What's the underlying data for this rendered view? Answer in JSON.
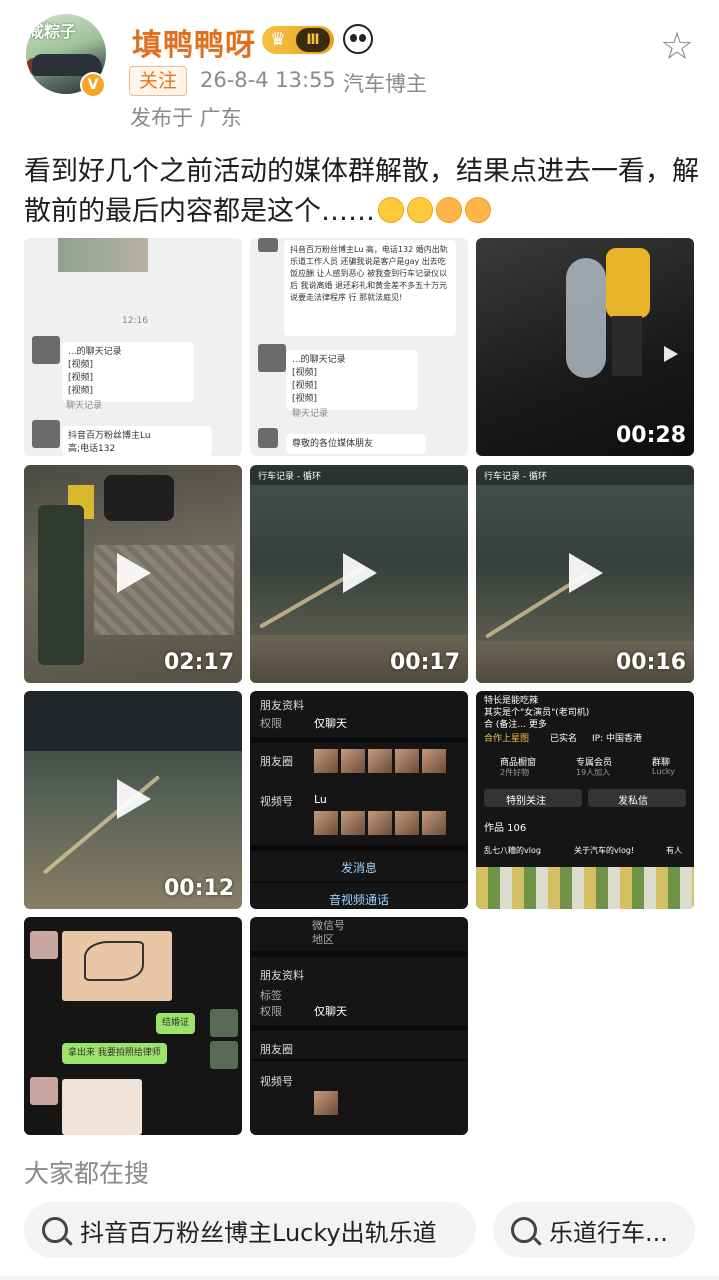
{
  "header": {
    "avatar_text": "咸粽子",
    "username": "填鸭鸭呀",
    "level_badge": "Ⅲ",
    "follow_label": "关注",
    "timestamp": "26-8-4 13:55",
    "user_tag": "汽车博主",
    "location": "发布于 广东"
  },
  "post": {
    "text": "看到好几个之前活动的媒体群解散，结果点进去一看，解散前的最后内容都是这个……"
  },
  "grid": {
    "cell1": {
      "time": "12:16",
      "forward_title": "...的聊天记录",
      "item1": "[视频]",
      "item2": "[视频]",
      "item3": "[视频]",
      "footer": "聊天记录",
      "bottom_text": "抖音百万粉丝博主Lu",
      "bottom_text2": "高;电话132"
    },
    "cell2": {
      "top_text": "抖音百万粉丝博主Lu 高，电话132 婚内出轨乐道工作人员 还骗我说是客户是gay 出去吃饭应酬 让人感到恶心 被我查到行车记录仪以后 我说离婚 退还彩礼和黄金差不多五十万元 说要走法律程序 行 那就法庭见!",
      "forward_title": "...的聊天记录",
      "item1": "[视频]",
      "item2": "[视频]",
      "item3": "[视频]",
      "footer": "聊天记录",
      "bottom_text": "尊敬的各位媒体朋友"
    },
    "video1": {
      "duration": "00:28"
    },
    "video2": {
      "duration": "02:17"
    },
    "video3": {
      "duration": "00:17",
      "hud": "行车记录 - 循环"
    },
    "video4": {
      "duration": "00:16",
      "hud": "行车记录 - 循环"
    },
    "video5": {
      "duration": "00:12"
    },
    "profile1": {
      "section": "朋友资料",
      "perm_label": "权限",
      "perm_value": "仅聊天",
      "moments_label": "朋友圈",
      "channels_label": "视频号",
      "channels_value": "Lu",
      "send_msg": "发消息",
      "av_call": "音视频通话"
    },
    "profile_douyin": {
      "line1": "特长是能吃辣",
      "line2": "其实是个\"女演员\"(老司机)",
      "line3": "合 (备注... 更多",
      "coop": "合作上星图",
      "verified": "已实名",
      "ip": "IP: 中国香港",
      "shop": "商品橱窗",
      "shop_sub": "2件好物",
      "member": "专属会员",
      "member_sub": "19人加入",
      "group": "群聊",
      "group_sub": "Lucky",
      "follow_btn": "特别关注",
      "msg_btn": "发私信",
      "works": "作品 106",
      "tag1": "乱七八糟的vlog",
      "tag2": "关于汽车的vlog!",
      "tag3": "有人"
    },
    "chat_cert": {
      "bubble1": "结婚证",
      "bubble2": "拿出来 我要拍照给律师"
    },
    "profile2": {
      "wechat_label": "微信号",
      "region_label": "地区",
      "section": "朋友资料",
      "tag_label": "标签",
      "perm_label": "权限",
      "perm_value": "仅聊天",
      "moments_label": "朋友圈",
      "channels_label": "视频号"
    }
  },
  "search": {
    "title": "大家都在搜",
    "pill1": "抖音百万粉丝博主Lucky出轨乐道",
    "pill2": "乐道行车..."
  }
}
